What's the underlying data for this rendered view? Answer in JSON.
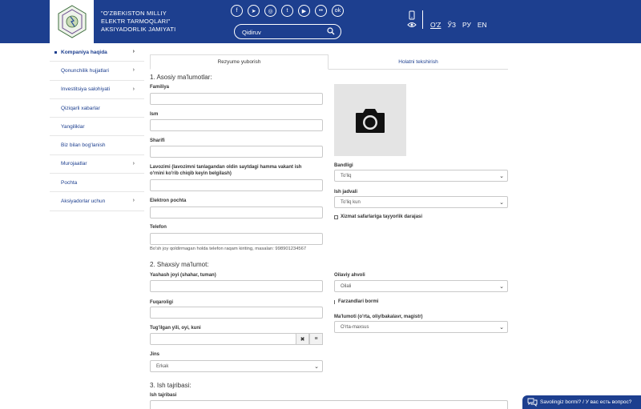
{
  "header": {
    "brand_line1": "\"O'ZBEKISTON MILLIY",
    "brand_line2": "ELEKTR TARMOQLARI\"",
    "brand_line3": "AKSIYADORLIK JAMIYATI",
    "social": [
      "facebook-icon",
      "telegram-icon",
      "instagram-icon",
      "twitter-icon",
      "youtube-icon",
      "flickr-icon",
      "odnoklassniki-icon"
    ],
    "search_placeholder": "Qidiruv",
    "languages": [
      "O'Z",
      "ЎЗ",
      "РУ",
      "EN"
    ],
    "active_language": "O'Z"
  },
  "sidebar": {
    "items": [
      {
        "label": "Kompaniya haqida",
        "active": true,
        "has_children": true
      },
      {
        "label": "Qonunchilik hujjatlari",
        "active": false,
        "has_children": true
      },
      {
        "label": "Investitsiya salohiyati",
        "active": false,
        "has_children": true
      },
      {
        "label": "Qiziqarli xabarlar",
        "active": false,
        "has_children": false
      },
      {
        "label": "Yangiliklar",
        "active": false,
        "has_children": false
      },
      {
        "label": "Biz bilan bog'lanish",
        "active": false,
        "has_children": false
      },
      {
        "label": "Murojaatlar",
        "active": false,
        "has_children": true
      },
      {
        "label": "Pochta",
        "active": false,
        "has_children": false
      },
      {
        "label": "Aksiyadorlar uchun",
        "active": false,
        "has_children": true
      }
    ]
  },
  "tabs": {
    "send": "Rezyume yuborish",
    "check": "Holatni tekshirish"
  },
  "form": {
    "section1": "1. Asosiy ma'lumotlar:",
    "familiya": "Familiya",
    "ism": "Ism",
    "sharif": "Sharifi",
    "lavozim": "Lavozimi (lavozimni tanlagandan oldin saytdagi hamma vakant ish",
    "lavozim2": "o'rnini ko'rib chiqib keyin belgilash)",
    "email": "Elektron pochta",
    "telefon": "Telefon",
    "telefon_hint": "Bo'sh joy qoldirmagan holda telefon raqam kiriting, masalan: 998901234567",
    "bandligi": "Bandligi",
    "bandligi_value": "To'liq",
    "ish_jadvali": "Ish jadvali",
    "ish_jadvali_value": "To'liq kun",
    "xizmat": "Xizmat safarlariga tayyorlik darajasi",
    "section2": "2. Shaxsiy ma'lumot:",
    "yashash": "Yashash joyi (shahar, tuman)",
    "oilaviy": "Oilaviy ahvoli",
    "oilaviy_value": "Oilali",
    "fuqarolik": "Fuqaroligi",
    "farzand": "Farzandlari bormi",
    "tugilgan": "Tug'ilgan yili, oyi, kuni",
    "malumot": "Ma'lumoti (o'rta, oliy/bakalavr, magistr)",
    "malumot_value": "O'rta-maxsus",
    "jins": "Jins",
    "jins_value": "Erkak",
    "section3": "3. Ish tajribasi:",
    "ish_tajribasi": "Ish tajribasi"
  },
  "chat": {
    "label": "Savolingiz bormi? / У вас есть вопрос?"
  }
}
